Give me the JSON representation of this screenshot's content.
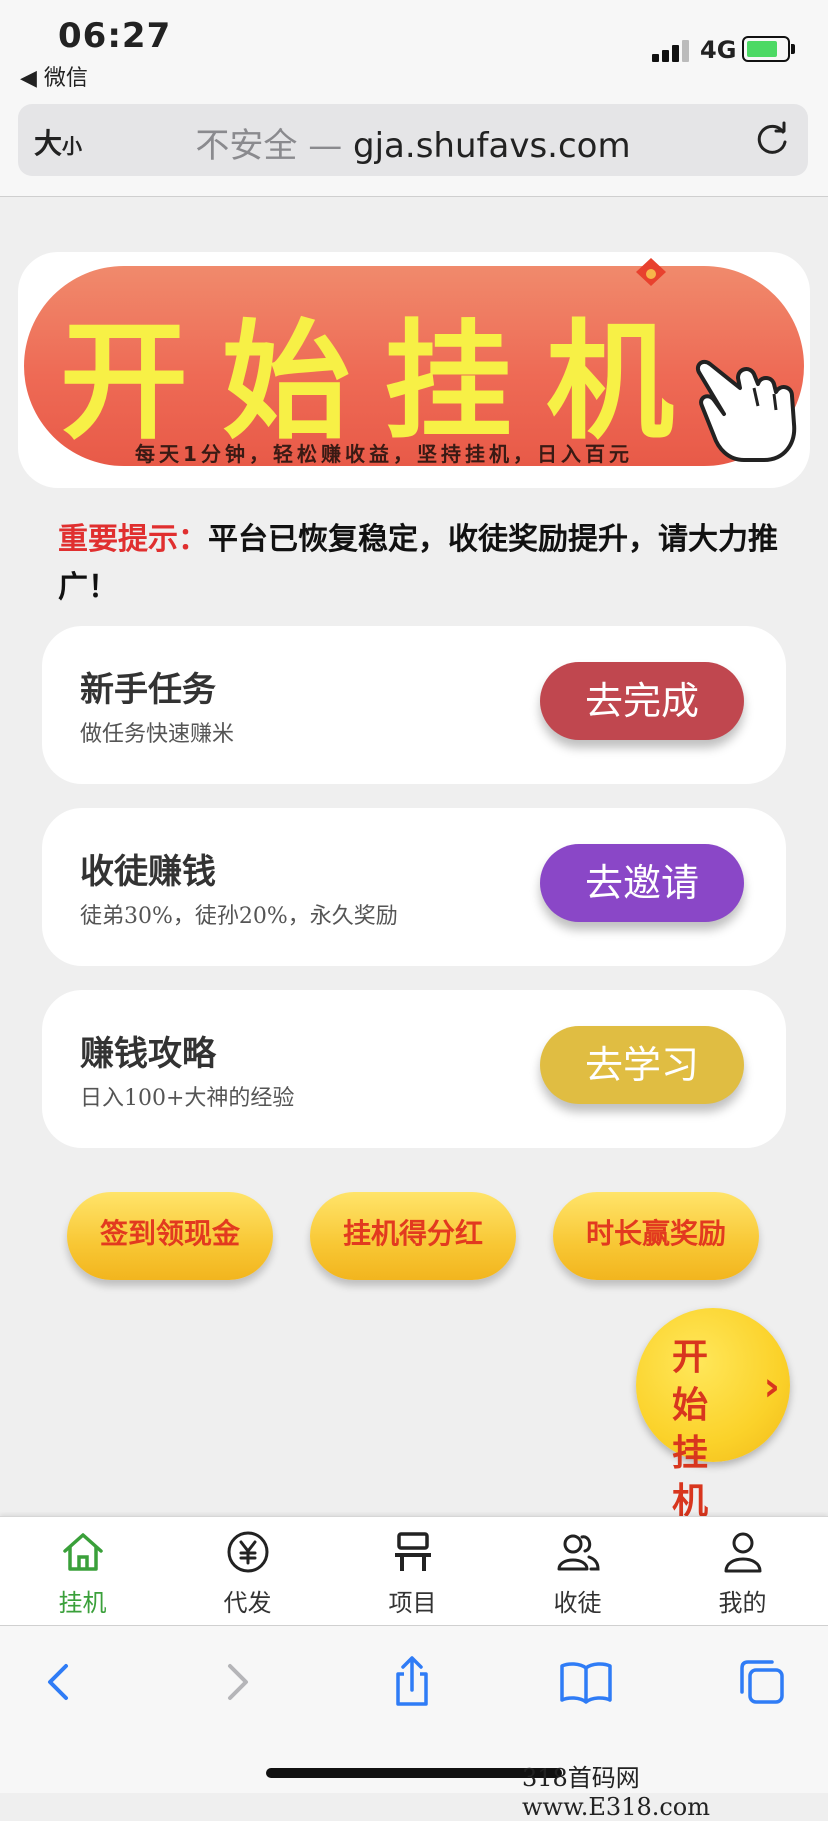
{
  "status_bar": {
    "time": "06:27",
    "back_app": "◀ 微信",
    "network": "4G"
  },
  "address_bar": {
    "text_size_big": "大",
    "text_size_small": "小",
    "insecure_label": "不安全 — ",
    "domain": "gja.shufavs.com"
  },
  "banner": {
    "title": "开始挂机",
    "subtitle": "每天1分钟，轻松赚收益，坚持挂机，日入百元"
  },
  "notice": {
    "highlight": "重要提示：",
    "text": "平台已恢复稳定，收徒奖励提升，请大力推广！"
  },
  "cards": [
    {
      "title": "新手任务",
      "desc": "做任务快速赚米",
      "button": "去完成",
      "button_color": "#c0474f"
    },
    {
      "title": "收徒赚钱",
      "desc": "徒弟30%，徒孙20%，永久奖励",
      "button": "去邀请",
      "button_color": "#8a47c7"
    },
    {
      "title": "赚钱攻略",
      "desc": "日入100+大神的经验",
      "button": "去学习",
      "button_color": "#e0bd42"
    }
  ],
  "pills": [
    "签到领现金",
    "挂机得分红",
    "时长赢奖励"
  ],
  "floating_button": {
    "label": "开始挂机",
    "arrow": "›"
  },
  "tabs": [
    {
      "label": "挂机",
      "icon": "home-icon",
      "active": true
    },
    {
      "label": "代发",
      "icon": "yuan-circle-icon",
      "active": false
    },
    {
      "label": "项目",
      "icon": "project-icon",
      "active": false
    },
    {
      "label": "收徒",
      "icon": "users-icon",
      "active": false
    },
    {
      "label": "我的",
      "icon": "user-icon",
      "active": false
    }
  ],
  "watermark": "318首码网  www.E318.com",
  "colors": {
    "accent_green": "#3aa03a",
    "notice_red": "#e02f2f",
    "safari_blue": "#2f7cf6"
  }
}
